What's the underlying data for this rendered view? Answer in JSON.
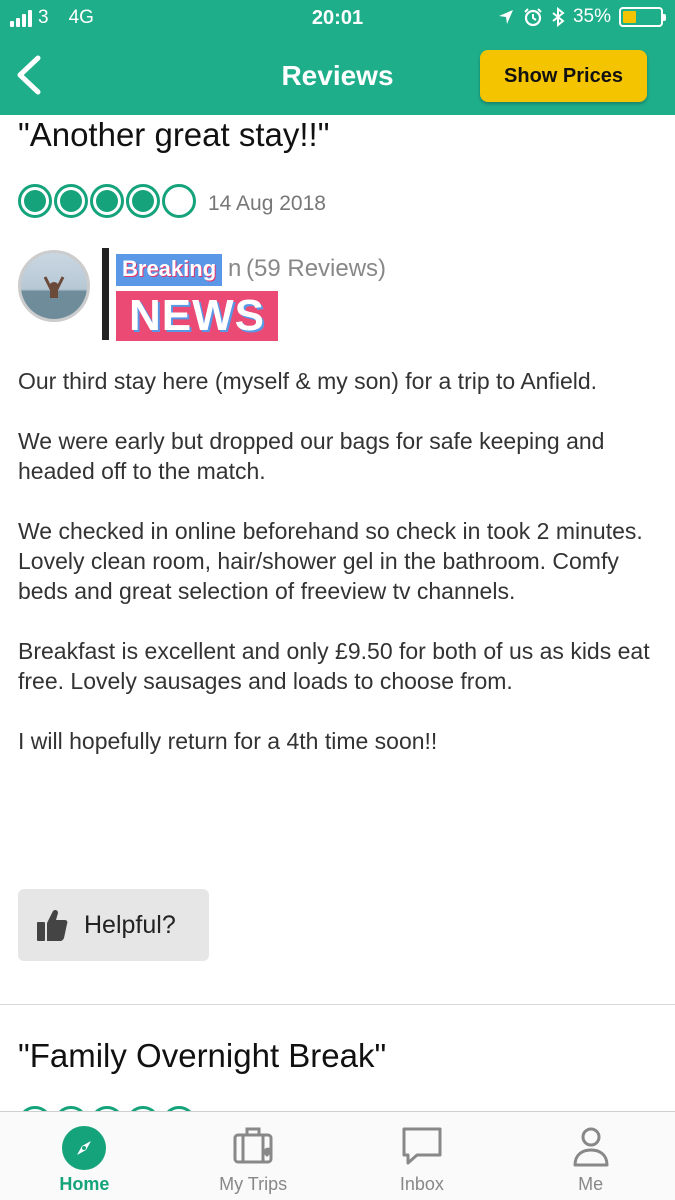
{
  "status_bar": {
    "carrier": "3",
    "network": "4G",
    "time": "20:01",
    "battery": "35%",
    "battery_level": 0.35
  },
  "header": {
    "title": "Reviews",
    "show_prices_label": "Show Prices",
    "back_icon": "chevron-left-icon"
  },
  "review": {
    "title": "\"Another great stay!!\"",
    "rating": 4,
    "rating_max": 5,
    "date": "14 Aug 2018",
    "reviewer_suffix": "n",
    "reviews_count": "(59 Reviews)",
    "overlay_breaking": "Breaking",
    "overlay_news": "NEWS",
    "paragraphs": [
      "Our third stay here (myself & my son) for a trip to Anfield.",
      "We were early but dropped our bags for safe keeping and headed off to the match.",
      "We checked in online beforehand so check in took 2 minutes. Lovely clean room, hair/shower gel in the bathroom. Comfy beds and great selection of freeview tv channels.",
      "Breakfast is excellent and only £9.50 for both of us as kids eat free. Lovely sausages and loads to choose from.",
      "I will hopefully return for a 4th time soon!!"
    ],
    "helpful_label": "Helpful?"
  },
  "next_review": {
    "title": "\"Family Overnight Break\""
  },
  "tabbar": {
    "tabs": [
      {
        "label": "Home",
        "icon": "compass-icon"
      },
      {
        "label": "My Trips",
        "icon": "suitcase-icon"
      },
      {
        "label": "Inbox",
        "icon": "chat-icon"
      },
      {
        "label": "Me",
        "icon": "person-icon"
      }
    ]
  },
  "colors": {
    "brand_green": "#1fae8a",
    "rating_green": "#14a37a",
    "button_yellow": "#f5c400"
  }
}
